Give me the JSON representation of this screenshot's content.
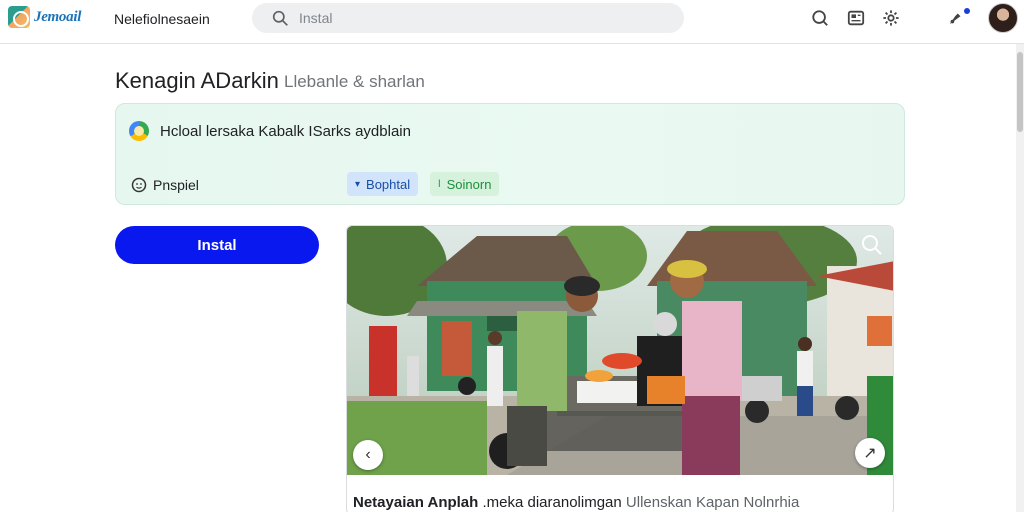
{
  "header": {
    "logo_text": "Jemoail",
    "nav_label": "Nelefiolnesaein",
    "search_placeholder": "Instal",
    "icons": [
      "search-icon",
      "news-icon",
      "settings-icon",
      "notifications-icon",
      "avatar"
    ]
  },
  "page": {
    "title": "Kenagin ADarkin",
    "subtitle": "Llebanle & sharlan"
  },
  "info_card": {
    "title": "Hcloal lersaka Kabalk ISarks aydblain",
    "people_label": "Pnspiel",
    "chip_primary": "Bophtal",
    "chip_secondary": "Soinorn"
  },
  "install_label": "Instal",
  "photo_card": {
    "caption_bold": "Netayaian Anplah",
    "caption_mid": ".meka diaranolimgan",
    "caption_muted": "Ullenskan Kapan Nolnrhia"
  },
  "colors": {
    "accent": "#0a18f0",
    "card_bg": "#e8f8f0",
    "chip_blue": "#d2e3fc",
    "chip_green": "#d6f2dc"
  }
}
